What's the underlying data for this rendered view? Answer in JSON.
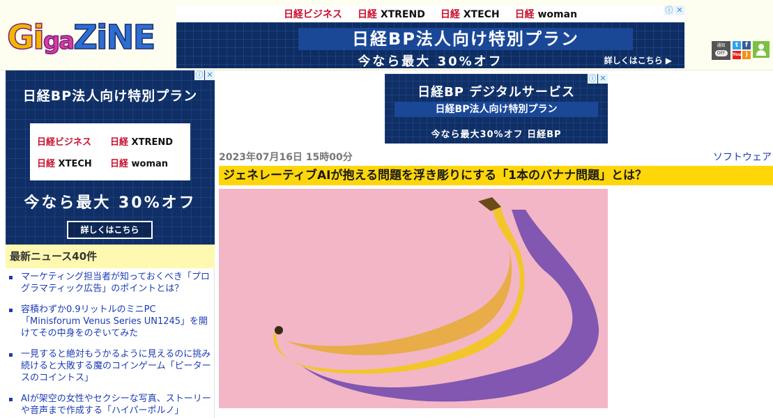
{
  "site": {
    "logo_text_1": "Gi",
    "logo_text_2": "ga",
    "logo_text_3": "ZiNE"
  },
  "ad_top": {
    "brands": [
      "日経ビジネス",
      "日経",
      "XTREND",
      "日経",
      "XTECH",
      "日経",
      "woman"
    ],
    "headline": "日経BP法人向け特別プラン",
    "subline": "今なら最大 30%オフ",
    "cta": "詳しくはこちら ▶"
  },
  "ad_close": {
    "info": "ⓘ",
    "close": "✕"
  },
  "social": {
    "notify_label": "通知",
    "notify_state": "OFF",
    "twitter": "t",
    "facebook": "f",
    "youtube": "You",
    "rss": ")"
  },
  "ad_side": {
    "title": "日経BP法人向け特別プラン",
    "brand_1": "日経ビジネス",
    "brand_2_pre": "日経",
    "brand_2": "XTREND",
    "brand_3_pre": "日経",
    "brand_3": "XTECH",
    "brand_4_pre": "日経",
    "brand_4": "woman",
    "sale": "今なら最大 30%オフ",
    "button": "詳しくはこちら"
  },
  "ad_main": {
    "line1": "日経BP デジタルサービス",
    "line2": "日経BP法人向け特別プラン",
    "line3": "今なら最大30%オフ 日経BP"
  },
  "sidebar": {
    "news_title": "最新ニュース40件",
    "news": [
      "マーケティング担当者が知っておくべき「プログラマティック広告」のポイントとは？",
      "容積わずか0.9リットルのミニPC「Minisforum Venus Series UN1245」を開けてその中身をのぞいてみた",
      "一見すると絶対もうかるように見えるのに挑み続けると大敗する魔のコインゲーム「ピータースのコイントス」",
      "AIが架空の女性やセクシーな写真、ストーリーや音声まで作成する「ハイパーポルノ」"
    ]
  },
  "article": {
    "date": "2023年07月16日 15時00分",
    "category": "ソフトウェア",
    "title": "ジェネレーティブAIが抱える問題を浮き彫りにする「1本のバナナ問題」とは？"
  },
  "colors": {
    "headline_bg": "#ffd60a",
    "news_head_bg": "#fff8b0",
    "link": "#1a3bb5",
    "hero_bg": "#f3b6c6",
    "banana": "#f2c62b"
  }
}
